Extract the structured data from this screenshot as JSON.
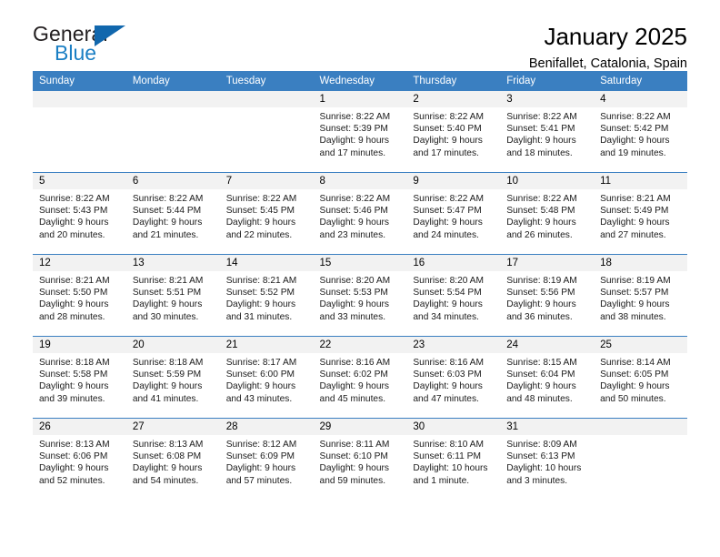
{
  "brand": {
    "name_line1": "General",
    "name_line2": "Blue",
    "accent_color": "#1b7fc4",
    "flag_color": "#1167ad"
  },
  "header": {
    "title": "January 2025",
    "subtitle": "Benifallet, Catalonia, Spain"
  },
  "calendar": {
    "header_bg": "#3a7fc1",
    "daynum_bg": "#f2f2f2",
    "weekday_headers": [
      "Sunday",
      "Monday",
      "Tuesday",
      "Wednesday",
      "Thursday",
      "Friday",
      "Saturday"
    ],
    "weeks": [
      [
        {
          "day": "",
          "blank": true,
          "sunrise": "",
          "sunset": "",
          "daylight_line1": "",
          "daylight_line2": ""
        },
        {
          "day": "",
          "blank": true,
          "sunrise": "",
          "sunset": "",
          "daylight_line1": "",
          "daylight_line2": ""
        },
        {
          "day": "",
          "blank": true,
          "sunrise": "",
          "sunset": "",
          "daylight_line1": "",
          "daylight_line2": ""
        },
        {
          "day": "1",
          "blank": false,
          "sunrise": "Sunrise: 8:22 AM",
          "sunset": "Sunset: 5:39 PM",
          "daylight_line1": "Daylight: 9 hours",
          "daylight_line2": "and 17 minutes."
        },
        {
          "day": "2",
          "blank": false,
          "sunrise": "Sunrise: 8:22 AM",
          "sunset": "Sunset: 5:40 PM",
          "daylight_line1": "Daylight: 9 hours",
          "daylight_line2": "and 17 minutes."
        },
        {
          "day": "3",
          "blank": false,
          "sunrise": "Sunrise: 8:22 AM",
          "sunset": "Sunset: 5:41 PM",
          "daylight_line1": "Daylight: 9 hours",
          "daylight_line2": "and 18 minutes."
        },
        {
          "day": "4",
          "blank": false,
          "sunrise": "Sunrise: 8:22 AM",
          "sunset": "Sunset: 5:42 PM",
          "daylight_line1": "Daylight: 9 hours",
          "daylight_line2": "and 19 minutes."
        }
      ],
      [
        {
          "day": "5",
          "blank": false,
          "sunrise": "Sunrise: 8:22 AM",
          "sunset": "Sunset: 5:43 PM",
          "daylight_line1": "Daylight: 9 hours",
          "daylight_line2": "and 20 minutes."
        },
        {
          "day": "6",
          "blank": false,
          "sunrise": "Sunrise: 8:22 AM",
          "sunset": "Sunset: 5:44 PM",
          "daylight_line1": "Daylight: 9 hours",
          "daylight_line2": "and 21 minutes."
        },
        {
          "day": "7",
          "blank": false,
          "sunrise": "Sunrise: 8:22 AM",
          "sunset": "Sunset: 5:45 PM",
          "daylight_line1": "Daylight: 9 hours",
          "daylight_line2": "and 22 minutes."
        },
        {
          "day": "8",
          "blank": false,
          "sunrise": "Sunrise: 8:22 AM",
          "sunset": "Sunset: 5:46 PM",
          "daylight_line1": "Daylight: 9 hours",
          "daylight_line2": "and 23 minutes."
        },
        {
          "day": "9",
          "blank": false,
          "sunrise": "Sunrise: 8:22 AM",
          "sunset": "Sunset: 5:47 PM",
          "daylight_line1": "Daylight: 9 hours",
          "daylight_line2": "and 24 minutes."
        },
        {
          "day": "10",
          "blank": false,
          "sunrise": "Sunrise: 8:22 AM",
          "sunset": "Sunset: 5:48 PM",
          "daylight_line1": "Daylight: 9 hours",
          "daylight_line2": "and 26 minutes."
        },
        {
          "day": "11",
          "blank": false,
          "sunrise": "Sunrise: 8:21 AM",
          "sunset": "Sunset: 5:49 PM",
          "daylight_line1": "Daylight: 9 hours",
          "daylight_line2": "and 27 minutes."
        }
      ],
      [
        {
          "day": "12",
          "blank": false,
          "sunrise": "Sunrise: 8:21 AM",
          "sunset": "Sunset: 5:50 PM",
          "daylight_line1": "Daylight: 9 hours",
          "daylight_line2": "and 28 minutes."
        },
        {
          "day": "13",
          "blank": false,
          "sunrise": "Sunrise: 8:21 AM",
          "sunset": "Sunset: 5:51 PM",
          "daylight_line1": "Daylight: 9 hours",
          "daylight_line2": "and 30 minutes."
        },
        {
          "day": "14",
          "blank": false,
          "sunrise": "Sunrise: 8:21 AM",
          "sunset": "Sunset: 5:52 PM",
          "daylight_line1": "Daylight: 9 hours",
          "daylight_line2": "and 31 minutes."
        },
        {
          "day": "15",
          "blank": false,
          "sunrise": "Sunrise: 8:20 AM",
          "sunset": "Sunset: 5:53 PM",
          "daylight_line1": "Daylight: 9 hours",
          "daylight_line2": "and 33 minutes."
        },
        {
          "day": "16",
          "blank": false,
          "sunrise": "Sunrise: 8:20 AM",
          "sunset": "Sunset: 5:54 PM",
          "daylight_line1": "Daylight: 9 hours",
          "daylight_line2": "and 34 minutes."
        },
        {
          "day": "17",
          "blank": false,
          "sunrise": "Sunrise: 8:19 AM",
          "sunset": "Sunset: 5:56 PM",
          "daylight_line1": "Daylight: 9 hours",
          "daylight_line2": "and 36 minutes."
        },
        {
          "day": "18",
          "blank": false,
          "sunrise": "Sunrise: 8:19 AM",
          "sunset": "Sunset: 5:57 PM",
          "daylight_line1": "Daylight: 9 hours",
          "daylight_line2": "and 38 minutes."
        }
      ],
      [
        {
          "day": "19",
          "blank": false,
          "sunrise": "Sunrise: 8:18 AM",
          "sunset": "Sunset: 5:58 PM",
          "daylight_line1": "Daylight: 9 hours",
          "daylight_line2": "and 39 minutes."
        },
        {
          "day": "20",
          "blank": false,
          "sunrise": "Sunrise: 8:18 AM",
          "sunset": "Sunset: 5:59 PM",
          "daylight_line1": "Daylight: 9 hours",
          "daylight_line2": "and 41 minutes."
        },
        {
          "day": "21",
          "blank": false,
          "sunrise": "Sunrise: 8:17 AM",
          "sunset": "Sunset: 6:00 PM",
          "daylight_line1": "Daylight: 9 hours",
          "daylight_line2": "and 43 minutes."
        },
        {
          "day": "22",
          "blank": false,
          "sunrise": "Sunrise: 8:16 AM",
          "sunset": "Sunset: 6:02 PM",
          "daylight_line1": "Daylight: 9 hours",
          "daylight_line2": "and 45 minutes."
        },
        {
          "day": "23",
          "blank": false,
          "sunrise": "Sunrise: 8:16 AM",
          "sunset": "Sunset: 6:03 PM",
          "daylight_line1": "Daylight: 9 hours",
          "daylight_line2": "and 47 minutes."
        },
        {
          "day": "24",
          "blank": false,
          "sunrise": "Sunrise: 8:15 AM",
          "sunset": "Sunset: 6:04 PM",
          "daylight_line1": "Daylight: 9 hours",
          "daylight_line2": "and 48 minutes."
        },
        {
          "day": "25",
          "blank": false,
          "sunrise": "Sunrise: 8:14 AM",
          "sunset": "Sunset: 6:05 PM",
          "daylight_line1": "Daylight: 9 hours",
          "daylight_line2": "and 50 minutes."
        }
      ],
      [
        {
          "day": "26",
          "blank": false,
          "sunrise": "Sunrise: 8:13 AM",
          "sunset": "Sunset: 6:06 PM",
          "daylight_line1": "Daylight: 9 hours",
          "daylight_line2": "and 52 minutes."
        },
        {
          "day": "27",
          "blank": false,
          "sunrise": "Sunrise: 8:13 AM",
          "sunset": "Sunset: 6:08 PM",
          "daylight_line1": "Daylight: 9 hours",
          "daylight_line2": "and 54 minutes."
        },
        {
          "day": "28",
          "blank": false,
          "sunrise": "Sunrise: 8:12 AM",
          "sunset": "Sunset: 6:09 PM",
          "daylight_line1": "Daylight: 9 hours",
          "daylight_line2": "and 57 minutes."
        },
        {
          "day": "29",
          "blank": false,
          "sunrise": "Sunrise: 8:11 AM",
          "sunset": "Sunset: 6:10 PM",
          "daylight_line1": "Daylight: 9 hours",
          "daylight_line2": "and 59 minutes."
        },
        {
          "day": "30",
          "blank": false,
          "sunrise": "Sunrise: 8:10 AM",
          "sunset": "Sunset: 6:11 PM",
          "daylight_line1": "Daylight: 10 hours",
          "daylight_line2": "and 1 minute."
        },
        {
          "day": "31",
          "blank": false,
          "sunrise": "Sunrise: 8:09 AM",
          "sunset": "Sunset: 6:13 PM",
          "daylight_line1": "Daylight: 10 hours",
          "daylight_line2": "and 3 minutes."
        },
        {
          "day": "",
          "blank": true,
          "sunrise": "",
          "sunset": "",
          "daylight_line1": "",
          "daylight_line2": ""
        }
      ]
    ]
  }
}
